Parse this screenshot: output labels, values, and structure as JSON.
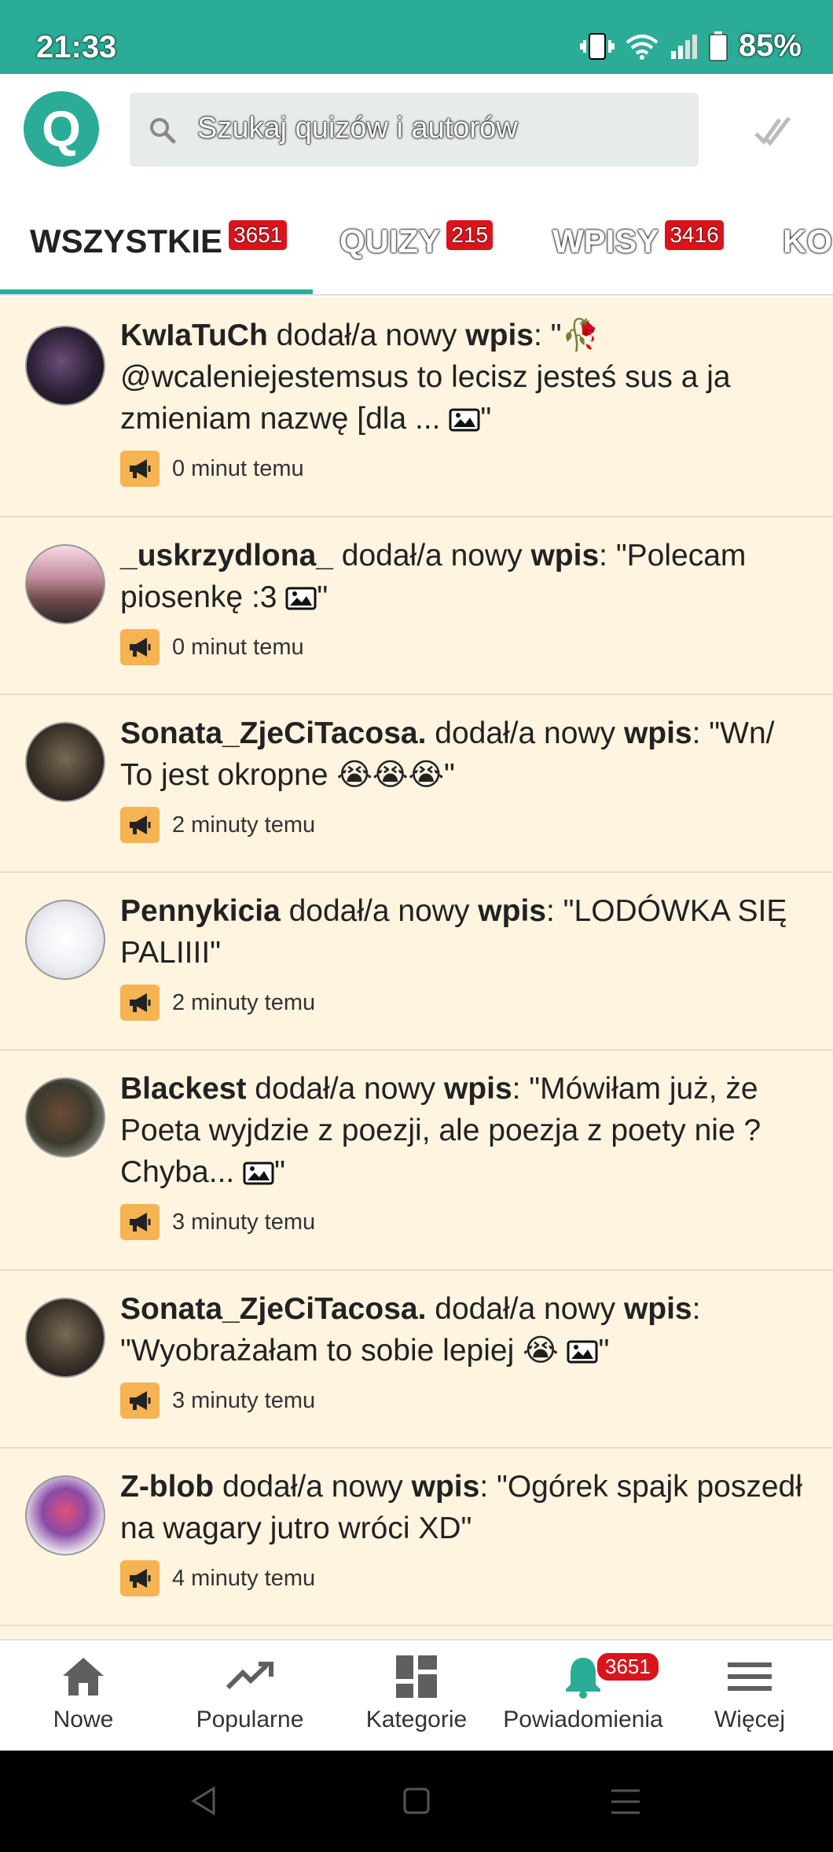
{
  "status": {
    "time": "21:33",
    "battery": "85%"
  },
  "header": {
    "logo_letter": "Q",
    "search_placeholder": "Szukaj quizów i autorów"
  },
  "tabs": [
    {
      "label": "WSZYSTKIE",
      "count": "3651"
    },
    {
      "label": "QUIZY",
      "count": "215"
    },
    {
      "label": "WPISY",
      "count": "3416"
    },
    {
      "label": "KO"
    }
  ],
  "feed": [
    {
      "user": "KwIaTuCh",
      "action": " dodał/a nowy ",
      "type": "wpis",
      "text": ": \"🥀 @wcaleniejestemsus to lecisz jesteś sus a ja zmieniam nazwę [dla ... ",
      "has_image": true,
      "end": "\"",
      "time": "0 minut temu"
    },
    {
      "user": "_uskrzydlona_",
      "action": " dodał/a nowy ",
      "type": "wpis",
      "text": ": \"Polecam piosenkę :3 ",
      "has_image": true,
      "end": "\"",
      "time": "0 minut temu"
    },
    {
      "user": "Sonata_ZjeCiTacosa.",
      "action": " dodał/a nowy ",
      "type": "wpis",
      "text": ": \"Wn/ To jest okropne 😭😭😭",
      "has_image": false,
      "end": "\"",
      "time": "2 minuty temu"
    },
    {
      "user": "Pennykicia",
      "action": " dodał/a nowy ",
      "type": "wpis",
      "text": ": \"LODÓWKA SIĘ PALIIII",
      "has_image": false,
      "end": "\"",
      "time": "2 minuty temu"
    },
    {
      "user": "Blackest",
      "action": " dodał/a nowy ",
      "type": "wpis",
      "text": ": \"Mówiłam już, że Poeta wyjdzie z poezji, ale poezja z poety nie ? Chyba... ",
      "has_image": true,
      "end": "\"",
      "time": "3 minuty temu"
    },
    {
      "user": "Sonata_ZjeCiTacosa.",
      "action": " dodał/a nowy ",
      "type": "wpis",
      "text": ": \"Wyobrażałam to sobie lepiej 😭 ",
      "has_image": true,
      "end": "\"",
      "time": "3 minuty temu"
    },
    {
      "user": "Z-blob",
      "action": " dodał/a nowy ",
      "type": "wpis",
      "text": ": \"Ogórek spajk poszedł na wagary jutro wróci XD",
      "has_image": false,
      "end": "\"",
      "time": "4 minuty temu"
    }
  ],
  "bottom_nav": [
    {
      "label": "Nowe",
      "icon": "home-icon"
    },
    {
      "label": "Popularne",
      "icon": "trending-icon"
    },
    {
      "label": "Kategorie",
      "icon": "grid-icon"
    },
    {
      "label": "Powiadomienia",
      "icon": "bell-icon",
      "badge": "3651"
    },
    {
      "label": "Więcej",
      "icon": "menu-icon"
    }
  ],
  "colors": {
    "brand": "#2bac96",
    "feed_bg": "#fff4e0",
    "badge": "#d9141c",
    "megaphone": "#f5b352"
  }
}
